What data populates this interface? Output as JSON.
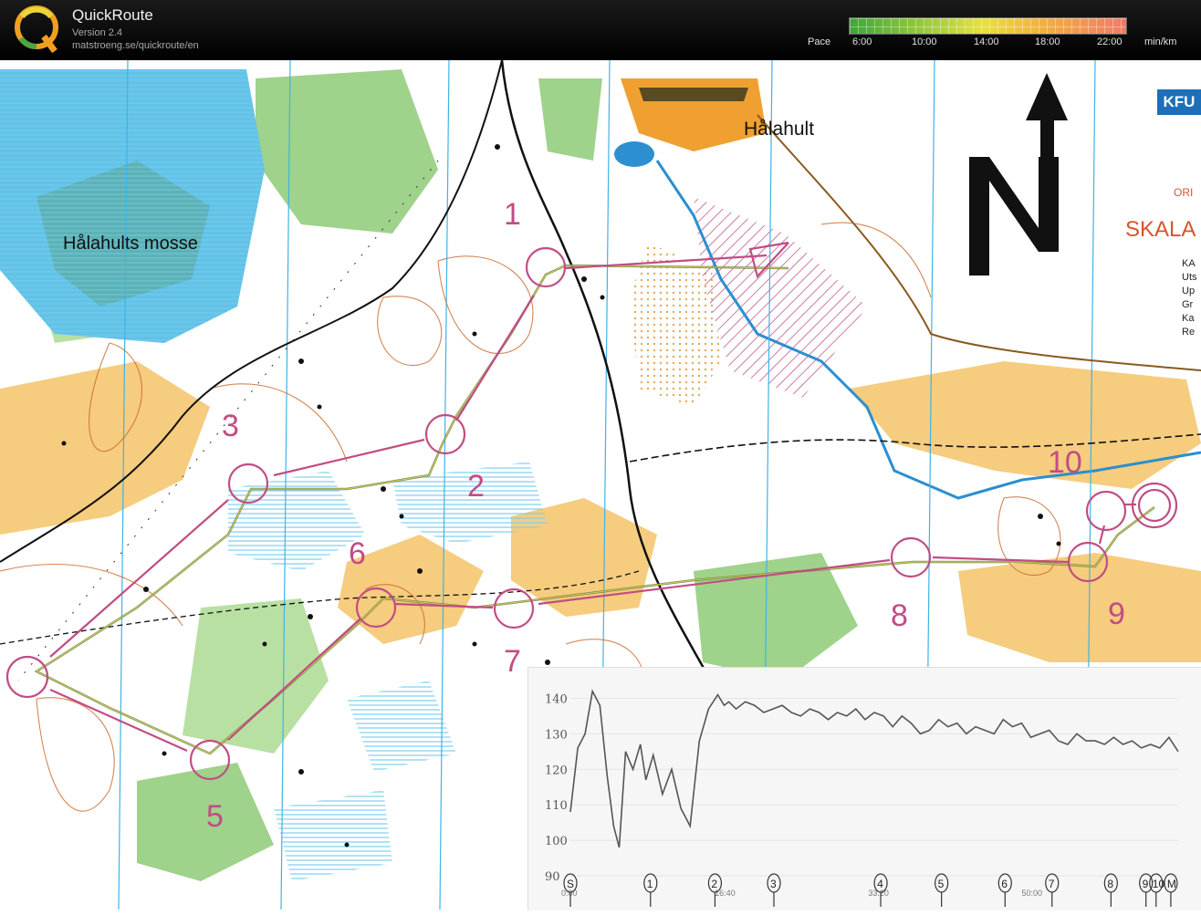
{
  "app": {
    "title": "QuickRoute",
    "version": "Version 2.4",
    "url": "matstroeng.se/quickroute/en",
    "logo_letter": "Q"
  },
  "pace_scale": {
    "label": "Pace",
    "ticks": [
      "6:00",
      "10:00",
      "14:00",
      "18:00",
      "22:00"
    ],
    "unit": "min/km",
    "colors": [
      "#3ea63a",
      "#9ccb3e",
      "#e8e040",
      "#f0b040",
      "#f07a6a"
    ]
  },
  "map": {
    "place_names": [
      "Hålahults mosse",
      "Hålahult",
      "SKALA",
      "ORI"
    ],
    "logo_text": "KFU",
    "north_letter": "N",
    "legend_lines": [
      "KA",
      "Uts",
      "Up",
      "Gr",
      "Ka",
      "Re"
    ],
    "control_labels": [
      "1",
      "2",
      "3",
      "5",
      "6",
      "7",
      "8",
      "9",
      "10"
    ],
    "colors": {
      "course": "#c14d84",
      "water": "#3fb3e6",
      "marsh": "#62c2e8",
      "open_land": "#f6cc7e",
      "green": "#9fd28b",
      "contours": "#c9682a",
      "route": "#6b7a3a"
    }
  },
  "chart_data": {
    "type": "line",
    "yticks": [
      90,
      100,
      110,
      120,
      130,
      140
    ],
    "ylim": [
      90,
      145
    ],
    "xticks": [
      "0:00",
      "16:40",
      "33:20",
      "50:00"
    ],
    "xlim_minutes": [
      0,
      66
    ],
    "control_marks": [
      "S",
      "1",
      "2",
      "3",
      "4",
      "5",
      "6",
      "7",
      "8",
      "9",
      "10",
      "M"
    ],
    "control_times_minutes": [
      0,
      8.7,
      15.7,
      22.1,
      33.7,
      40.3,
      47.2,
      52.3,
      58.7,
      62.5,
      63.6,
      65.2
    ],
    "series": [
      {
        "x": [
          0,
          0.8,
          1.6,
          2.4,
          3.2,
          4,
          4.7,
          5.3,
          6,
          6.8,
          7.6,
          8.2,
          9,
          10,
          11,
          12,
          13,
          14,
          15,
          16,
          16.7,
          17.2,
          18,
          19,
          20,
          21,
          22,
          23,
          24,
          25,
          26,
          27,
          28,
          29,
          30,
          31,
          32,
          33,
          34,
          35,
          36,
          37,
          38,
          39,
          40,
          41,
          42,
          43,
          44,
          45,
          46,
          47,
          48,
          49,
          50,
          51,
          52,
          53,
          54,
          55,
          56,
          57,
          58,
          59,
          60,
          61,
          62,
          63,
          64,
          65,
          66
        ],
        "y": [
          108,
          126,
          130,
          142,
          138,
          118,
          104,
          98,
          125,
          120,
          127,
          117,
          124,
          113,
          120,
          109,
          104,
          128,
          137,
          141,
          138,
          139,
          137,
          139,
          138,
          136,
          137,
          138,
          136,
          135,
          137,
          136,
          134,
          136,
          135,
          137,
          134,
          136,
          135,
          132,
          135,
          133,
          130,
          131,
          134,
          132,
          133,
          130,
          132,
          131,
          130,
          134,
          132,
          133,
          129,
          130,
          131,
          128,
          127,
          130,
          128,
          128,
          127,
          129,
          127,
          128,
          126,
          127,
          126,
          129,
          125
        ]
      }
    ]
  }
}
